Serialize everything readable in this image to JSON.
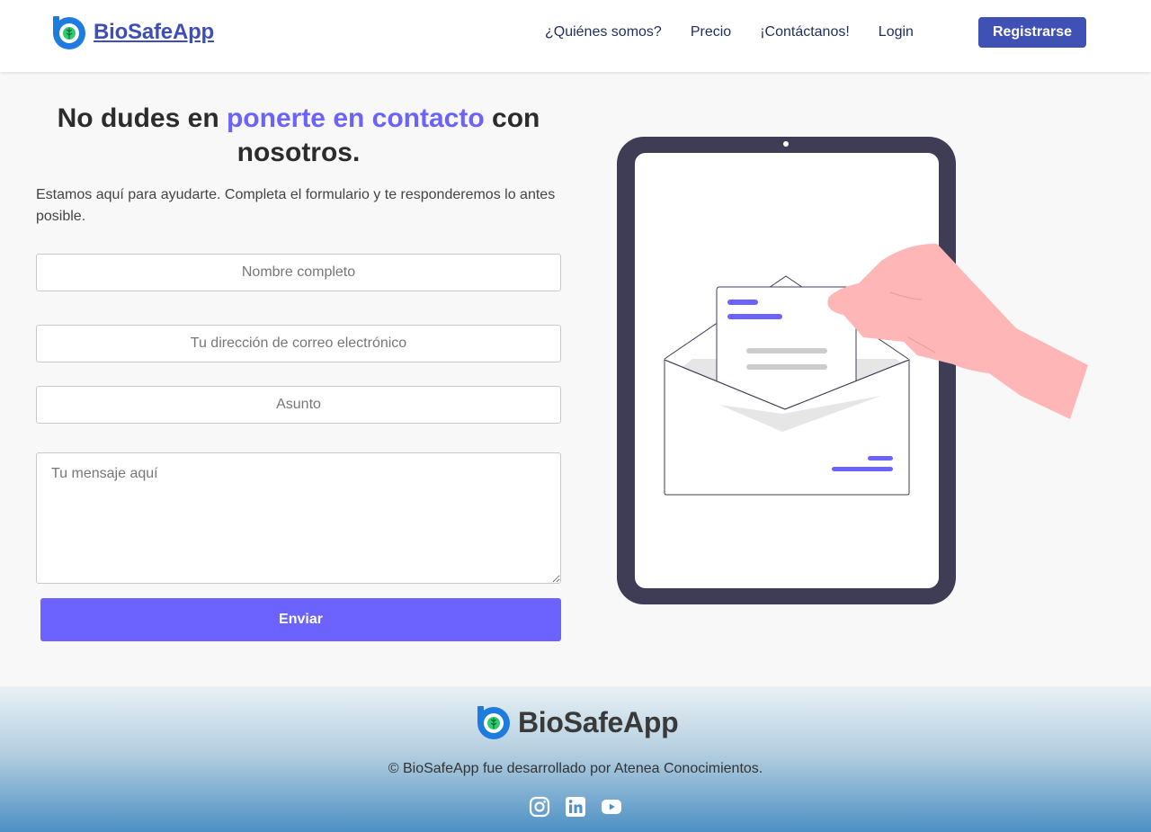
{
  "header": {
    "brand": "BioSafeApp",
    "nav": [
      {
        "label": "¿Quiénes somos?"
      },
      {
        "label": "Precio"
      },
      {
        "label": "¡Contáctanos!"
      },
      {
        "label": "Login"
      }
    ],
    "register_label": "Registrarse"
  },
  "main": {
    "title_part1": "No dudes en ",
    "title_accent": "ponerte en contacto",
    "title_part2": " con nosotros.",
    "intro": "Estamos aquí para ayudarte. Completa el formulario y te responderemos lo antes posible.",
    "form": {
      "name_placeholder": "Nombre completo",
      "email_placeholder": "Tu dirección de correo electrónico",
      "subject_placeholder": "Asunto",
      "message_placeholder": "Tu mensaje aquí",
      "submit_label": "Enviar"
    }
  },
  "footer": {
    "brand": "BioSafeApp",
    "copyright": "© BioSafeApp fue desarrollado por Atenea Conocimientos.",
    "socials": [
      "instagram-icon",
      "linkedin-icon",
      "youtube-icon"
    ]
  },
  "colors": {
    "primary": "#3f51b5",
    "accent": "#6c63ff",
    "brand_text": "#3d4fb6",
    "tablet_frame": "#3f3d56",
    "hand": "#ffb6b6"
  }
}
